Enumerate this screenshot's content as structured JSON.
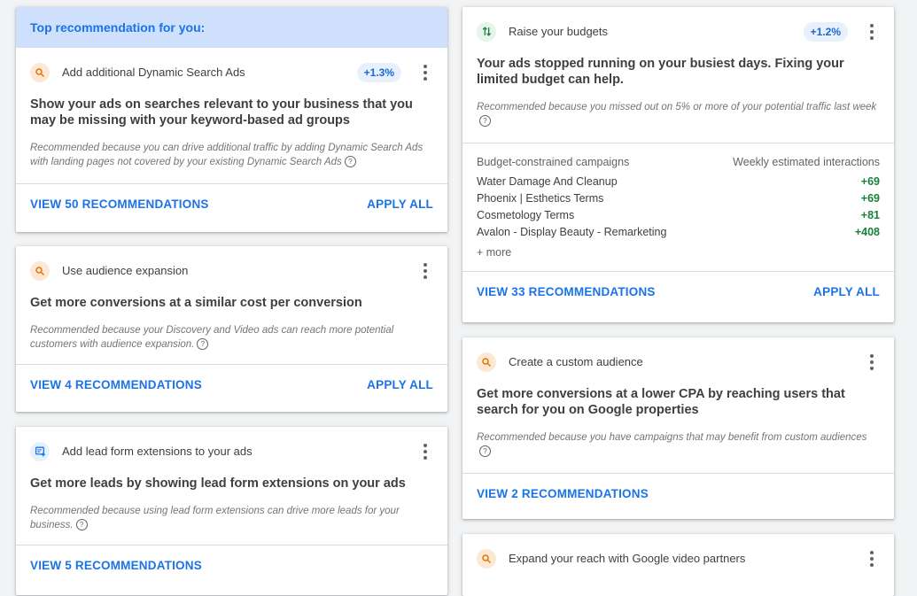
{
  "top_banner": "Top recommendation for you:",
  "cards": {
    "dsa": {
      "title": "Add additional Dynamic Search Ads",
      "badge": "+1.3%",
      "headline": "Show your ads on searches relevant to your business that you may be missing with your keyword-based ad groups",
      "reason": "Recommended because you can drive additional traffic by adding Dynamic Search Ads with landing pages not covered by your existing Dynamic Search Ads",
      "view": "VIEW 50 RECOMMENDATIONS",
      "apply": "APPLY ALL",
      "icon": "search-icon"
    },
    "audience_expansion": {
      "title": "Use audience expansion",
      "headline": "Get more conversions at a similar cost per conversion",
      "reason": "Recommended because your Discovery and Video ads can reach more potential customers with audience expansion.",
      "view": "VIEW 4 RECOMMENDATIONS",
      "apply": "APPLY ALL",
      "icon": "search-icon"
    },
    "lead_form": {
      "title": "Add lead form extensions to your ads",
      "headline": "Get more leads by showing lead form extensions on your ads",
      "reason": "Recommended because using lead form extensions can drive more leads for your business.",
      "view": "VIEW 5 RECOMMENDATIONS",
      "icon": "form-add-icon"
    },
    "budgets": {
      "title": "Raise your budgets",
      "badge": "+1.2%",
      "headline": "Your ads stopped running on your busiest days. Fixing your limited budget can help.",
      "reason": "Recommended because you missed out on 5% or more of your potential traffic last week",
      "table_header_left": "Budget-constrained campaigns",
      "table_header_right": "Weekly estimated interactions",
      "rows": [
        {
          "name": "Water Damage And Cleanup",
          "value": "+69"
        },
        {
          "name": "Phoenix | Esthetics Terms",
          "value": "+69"
        },
        {
          "name": "Cosmetology Terms",
          "value": "+81"
        },
        {
          "name": "Avalon - Display Beauty - Remarketing",
          "value": "+408"
        }
      ],
      "more": "+ more",
      "view": "VIEW 33 RECOMMENDATIONS",
      "apply": "APPLY ALL",
      "icon": "arrows-up-down-icon"
    },
    "custom_audience": {
      "title": "Create a custom audience",
      "headline": "Get more conversions at a lower CPA by reaching users that search for you on Google properties",
      "reason": "Recommended because you have campaigns that may benefit from custom audiences",
      "view": "VIEW 2 RECOMMENDATIONS",
      "icon": "search-icon"
    },
    "video_partners": {
      "title": "Expand your reach with Google video partners",
      "icon": "search-icon"
    }
  },
  "colors": {
    "accent": "#1a73e8",
    "banner": "#cfe0fc",
    "positive": "#188038",
    "search_icon": "#e37400"
  }
}
